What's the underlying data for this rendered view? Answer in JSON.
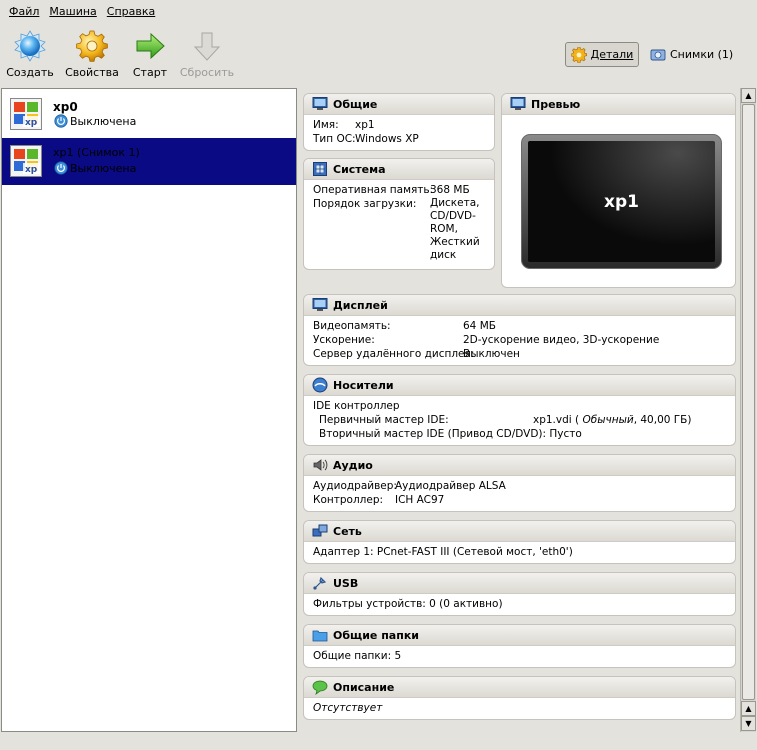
{
  "menu": [
    "Файл",
    "Машина",
    "Справка"
  ],
  "toolbar": {
    "create": "Создать",
    "settings": "Свойства",
    "start": "Старт",
    "discard": "Сбросить",
    "details": "Детали",
    "snapshots": "Снимки (1)"
  },
  "vms": [
    {
      "name": "xp0",
      "state": "Выключена"
    },
    {
      "name": "xp1 (Снимок 1)",
      "state": "Выключена"
    }
  ],
  "general": {
    "title": "Общие",
    "name_label": "Имя:",
    "name_value": "xp1",
    "os_label": "Тип ОС:",
    "os_value": "Windows XP"
  },
  "preview": {
    "title": "Превью",
    "vm_name": "xp1"
  },
  "system": {
    "title": "Система",
    "ram_label": "Оперативная память:",
    "ram_value": "368 МБ",
    "boot_label": "Порядок загрузки:",
    "boot_values": [
      "Дискета,",
      "CD/DVD-",
      "ROM,",
      "Жесткий",
      "диск"
    ]
  },
  "display": {
    "title": "Дисплей",
    "vram_label": "Видеопамять:",
    "vram_value": "64 МБ",
    "accel_label": "Ускорение:",
    "accel_value": "2D-ускорение видео, 3D-ускорение",
    "rdp_label": "Сервер удалённого дисплея:",
    "rdp_value": "Выключен"
  },
  "storage": {
    "title": "Носители",
    "controller": "IDE контроллер",
    "primary_label": "Первичный мастер IDE:",
    "primary_file": "xp1.vdi (",
    "primary_type": "Обычный",
    "primary_size": ", 40,00 ГБ)",
    "secondary_label": "Вторичный мастер IDE (Привод CD/DVD):",
    "secondary_value": "Пусто"
  },
  "audio": {
    "title": "Аудио",
    "driver_label": "Аудиодрайвер:",
    "driver_value": "Аудиодрайвер ALSA",
    "ctrl_label": "Контроллер:",
    "ctrl_value": "ICH AC97"
  },
  "network": {
    "title": "Сеть",
    "adapter": "Адаптер 1: PCnet-FAST III (Сетевой мост, 'eth0')"
  },
  "usb": {
    "title": "USB",
    "filters": "Фильтры устройств: 0 (0 активно)"
  },
  "shared": {
    "title": "Общие папки",
    "folders": "Общие папки: 5"
  },
  "description": {
    "title": "Описание",
    "text": "Отсутствует"
  },
  "colors": {
    "selection": "#0a0a84",
    "background": "#e4e2dd"
  }
}
